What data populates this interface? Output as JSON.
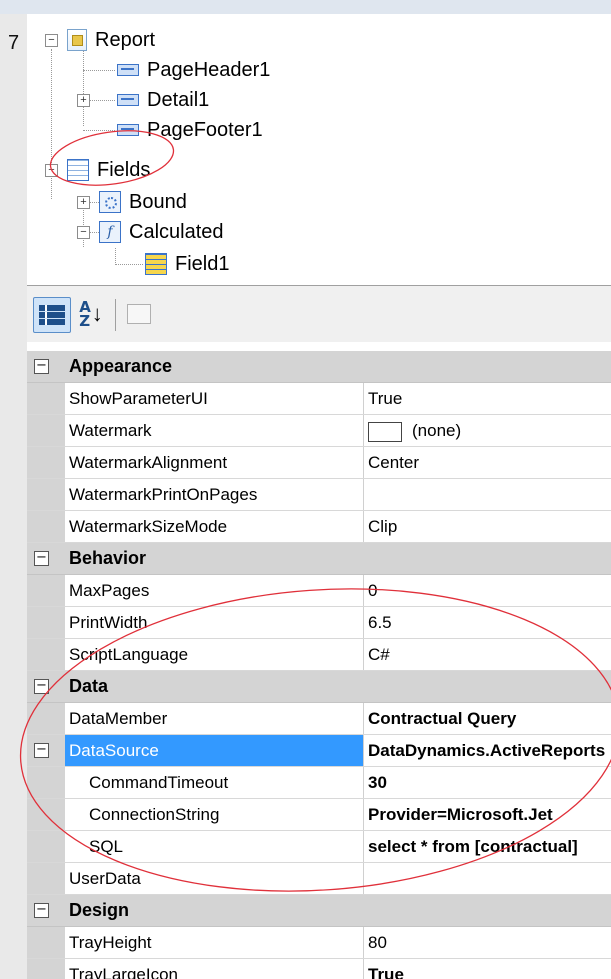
{
  "left_margin_number": "7",
  "tree": {
    "report": "Report",
    "page_header": "PageHeader1",
    "detail": "Detail1",
    "page_footer": "PageFooter1",
    "fields": "Fields",
    "bound": "Bound",
    "calculated": "Calculated",
    "field1": "Field1"
  },
  "toolbar": {
    "categorized": "categorized-icon",
    "alphabetical": "sort-alpha-icon",
    "property_pages": "property-pages-icon"
  },
  "grid": {
    "appearance": {
      "title": "Appearance",
      "show_parameter_ui": {
        "name": "ShowParameterUI",
        "value": "True"
      },
      "watermark": {
        "name": "Watermark",
        "value": "(none)"
      },
      "watermark_alignment": {
        "name": "WatermarkAlignment",
        "value": "Center"
      },
      "watermark_print_on_pages": {
        "name": "WatermarkPrintOnPages",
        "value": ""
      },
      "watermark_size_mode": {
        "name": "WatermarkSizeMode",
        "value": "Clip"
      }
    },
    "behavior": {
      "title": "Behavior",
      "max_pages": {
        "name": "MaxPages",
        "value": "0"
      },
      "print_width": {
        "name": "PrintWidth",
        "value": "6.5"
      },
      "script_language": {
        "name": "ScriptLanguage",
        "value": "C#"
      }
    },
    "data": {
      "title": "Data",
      "data_member": {
        "name": "DataMember",
        "value": "Contractual Query"
      },
      "data_source": {
        "name": "DataSource",
        "value": "DataDynamics.ActiveReports"
      },
      "command_timeout": {
        "name": "CommandTimeout",
        "value": "30"
      },
      "connection_string": {
        "name": "ConnectionString",
        "value": "Provider=Microsoft.Jet"
      },
      "sql": {
        "name": "SQL",
        "value": "select * from [contractual]"
      },
      "user_data": {
        "name": "UserData",
        "value": ""
      }
    },
    "design": {
      "title": "Design",
      "tray_height": {
        "name": "TrayHeight",
        "value": "80"
      },
      "tray_large_icon": {
        "name": "TrayLargeIcon",
        "value": "True"
      }
    }
  },
  "colors": {
    "selection": "#3399ff",
    "annotation": "#e0303a",
    "category_row": "#d4d4d4"
  }
}
